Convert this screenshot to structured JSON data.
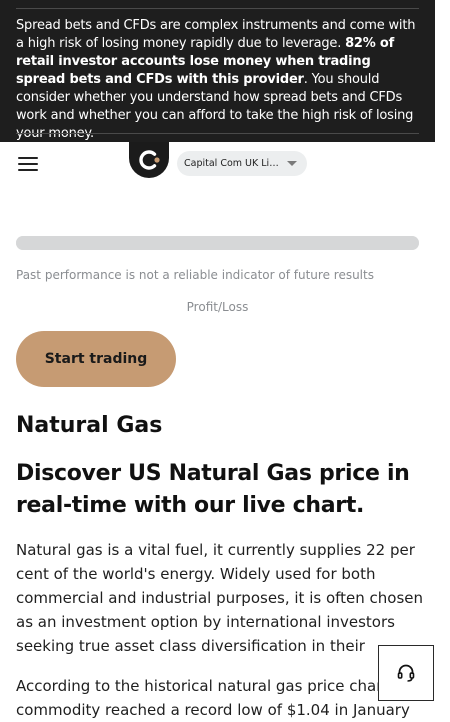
{
  "risk_warning": {
    "text_before": "Spread bets and CFDs are complex instruments and come with a high risk of losing money rapidly due to leverage. ",
    "text_bold": "82% of retail investor accounts lose money when trading spread bets and CFDs with this provider",
    "text_after": ". You should consider whether you understand how spread bets and CFDs work and whether you can afford to take the high risk of losing your money."
  },
  "header": {
    "menu_icon": "hamburger-menu-icon",
    "logo_icon": "capital-com-logo",
    "entity_select": {
      "selected": "Capital Com UK Limited",
      "caret_icon": "chevron-down-icon"
    }
  },
  "chart_placeholder": {
    "progress_fraction": 1.0,
    "disclaimer": "Past performance is not a reliable indicator of future results",
    "pl_label": "Profit/Loss"
  },
  "cta": {
    "label": "Start trading"
  },
  "article": {
    "asset_title": "Natural Gas",
    "headline": "Discover US Natural Gas price in real-time with our live chart.",
    "paragraphs": [
      "Natural gas is a vital fuel, it currently supplies 22 per cent of the world's energy. Widely used for both commercial and industrial purposes, it is often chosen as an investment option by international investors seeking true asset class diversification in their portfolio.",
      "According to the historical natural gas price chart, the commodity reached a record low of $1.04 in January"
    ]
  },
  "support": {
    "icon": "headset-support-icon"
  },
  "colors": {
    "banner_bg": "#1e1e1e",
    "cta_bg": "#c69b73",
    "select_bg": "#eceeef",
    "muted_text": "#8a8d91"
  }
}
